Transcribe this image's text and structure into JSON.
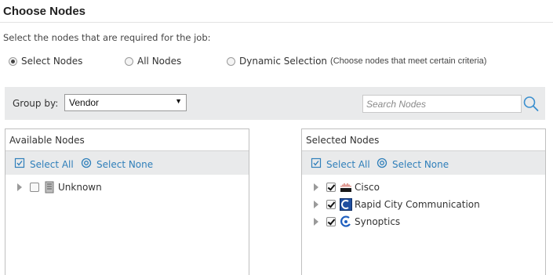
{
  "page": {
    "title": "Choose Nodes",
    "instructions": "Select the nodes that are required for the job:"
  },
  "selection_mode": {
    "options": [
      {
        "label": "Select Nodes",
        "selected": true
      },
      {
        "label": "All Nodes",
        "selected": false
      },
      {
        "label": "Dynamic Selection",
        "note": "(Choose nodes that meet certain criteria)",
        "selected": false
      }
    ]
  },
  "toolbar": {
    "group_by_label": "Group by:",
    "group_by_value": "Vendor",
    "search_placeholder": "Search Nodes",
    "search_value": ""
  },
  "available": {
    "header": "Available Nodes",
    "select_all": "Select All",
    "select_none": "Select None",
    "items": [
      {
        "label": "Unknown",
        "checked": false,
        "icon": "server-icon"
      }
    ]
  },
  "selected": {
    "header": "Selected Nodes",
    "select_all": "Select All",
    "select_none": "Select None",
    "items": [
      {
        "label": "Cisco",
        "checked": true,
        "icon": "cisco-logo-icon"
      },
      {
        "label": "Rapid City Communication",
        "checked": true,
        "icon": "rapid-city-logo-icon"
      },
      {
        "label": "Synoptics",
        "checked": true,
        "icon": "synoptics-logo-icon"
      }
    ]
  },
  "colors": {
    "link": "#2f7fba",
    "toolbar_bg": "#e9eaeb",
    "panel_border": "#bfbfbf"
  }
}
